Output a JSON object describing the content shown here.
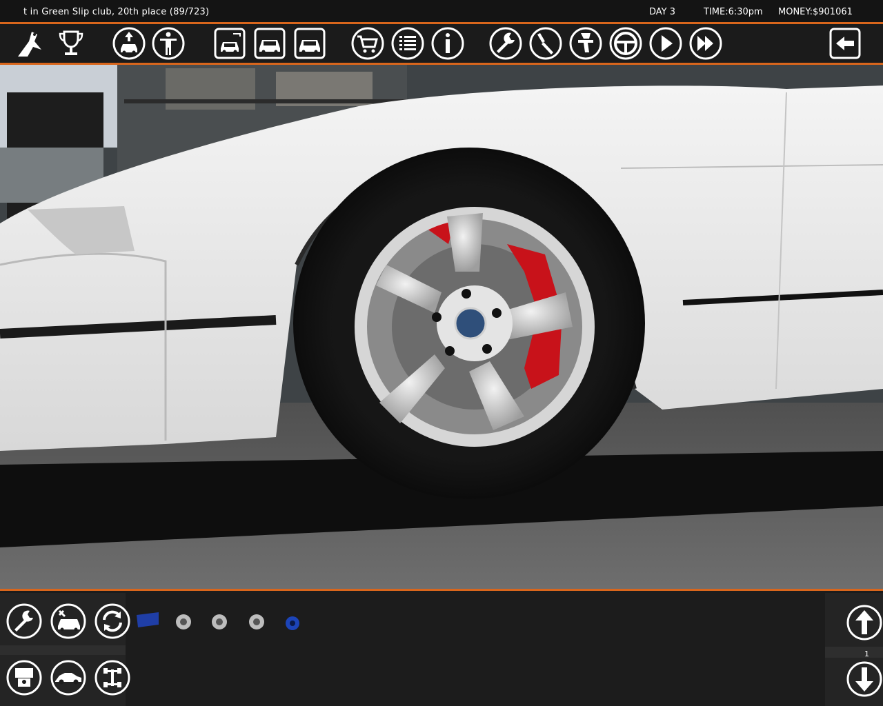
{
  "status": {
    "event_text": "t in Green Slip club, 20th place (89/723)",
    "day": "DAY 3",
    "time": "TIME:6:30pm",
    "money": "MONEY:$901061"
  },
  "top_toolbar": {
    "icons": [
      "club-logo-icon",
      "trophy-icon",
      "car-lift-icon",
      "person-icon",
      "car-garage-1-icon",
      "car-garage-2-icon",
      "car-garage-3-icon",
      "shopping-cart-icon",
      "list-icon",
      "info-icon",
      "wrench-icon",
      "screwdriver-icon",
      "paint-gun-icon",
      "steering-wheel-icon",
      "play-icon",
      "fast-forward-icon",
      "back-arrow-icon"
    ]
  },
  "bottom_panel": {
    "tool_icons": [
      "wrench-icon",
      "repair-car-icon",
      "rotate-icon",
      "engine-piston-icon",
      "car-body-icon",
      "chassis-icon"
    ],
    "page_number": "1",
    "colors": {
      "accent": "#d9661c",
      "panel": "#1c1c1c",
      "icon": "#ffffff"
    }
  }
}
